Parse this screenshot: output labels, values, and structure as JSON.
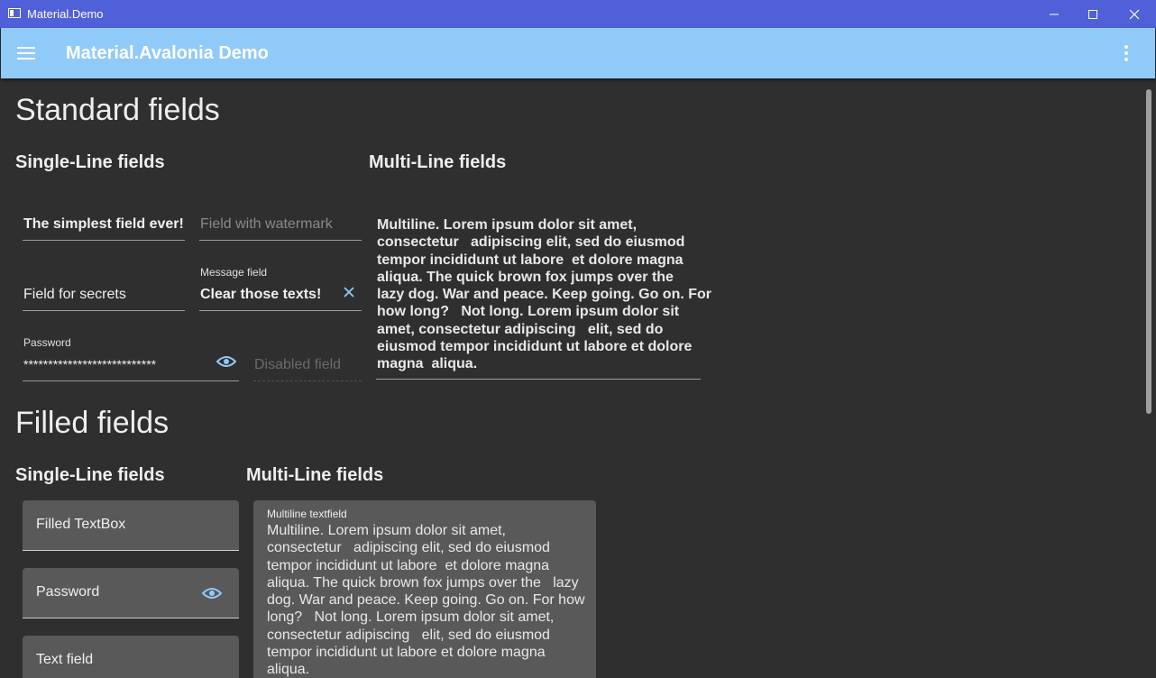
{
  "window": {
    "title": "Material.Demo"
  },
  "appbar": {
    "title": "Material.Avalonia Demo"
  },
  "standard": {
    "heading": "Standard fields",
    "single_heading": "Single-Line fields",
    "multi_heading": "Multi-Line fields",
    "simplest_value": "The simplest field ever!",
    "watermark_placeholder": "Field with watermark",
    "secrets_placeholder": "Field for secrets",
    "message_label": "Message field",
    "message_value": "Clear those texts!",
    "password_label": "Password",
    "password_value": "***************************",
    "disabled_placeholder": "Disabled field",
    "multiline_value": "Multiline. Lorem ipsum dolor sit amet,\nconsectetur   adipiscing elit, sed do eiusmod\ntempor incididunt ut labore  et dolore magna\naliqua. The quick brown fox jumps over the\nlazy dog. War and peace. Keep going. Go on. For\nhow long?   Not long. Lorem ipsum dolor sit\namet, consectetur adipiscing   elit, sed do\neiusmod tempor incididunt ut labore et dolore\nmagna  aliqua."
  },
  "filled": {
    "heading": "Filled fields",
    "single_heading": "Single-Line fields",
    "multi_heading": "Multi-Line fields",
    "textbox_placeholder": "Filled TextBox",
    "password_placeholder": "Password",
    "textfield_placeholder": "Text field",
    "multiline_label": "Multiline textfield",
    "multiline_value": "Multiline. Lorem ipsum dolor sit amet,\nconsectetur   adipiscing elit, sed do eiusmod\ntempor incididunt ut labore  et dolore magna\naliqua. The quick brown fox jumps over the   lazy\ndog. War and peace. Keep going. Go on. For how\nlong?   Not long. Lorem ipsum dolor sit amet,\nconsectetur adipiscing   elit, sed do eiusmod\ntempor incididunt ut labore et dolore magna\naliqua."
  },
  "icons": {
    "hamburger": "menu-icon",
    "more": "more-vert-icon",
    "eye": "eye-icon",
    "clear": "close-icon",
    "minimize": "minimize-icon",
    "maximize": "maximize-icon",
    "close_window": "close-window-icon"
  },
  "colors": {
    "titlebar": "#5060d8",
    "appbar": "#90caf9",
    "background": "#2f2f2f",
    "filled_bg": "#595959",
    "accent_icon": "#90caf9"
  }
}
